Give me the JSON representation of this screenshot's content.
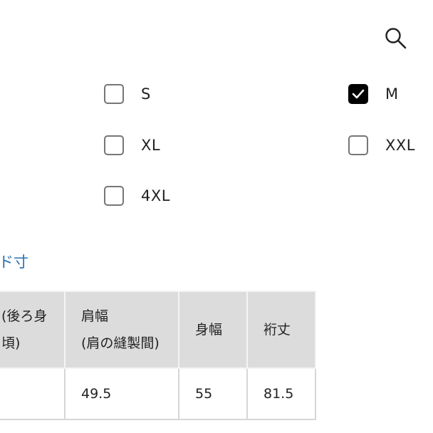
{
  "header": {
    "search_icon": "search-icon"
  },
  "size_options": [
    {
      "label": "S",
      "checked": false
    },
    {
      "label": "M",
      "checked": true
    },
    {
      "label": "XL",
      "checked": false
    },
    {
      "label": "XXL",
      "checked": false
    },
    {
      "label": "4XL",
      "checked": false
    }
  ],
  "section": {
    "link_text": "ヌード寸"
  },
  "table": {
    "headers": {
      "back_length": "(後ろ身頃)",
      "shoulder_line1": "肩幅",
      "shoulder_line2": "(肩の縫製間)",
      "body_width": "身幅",
      "sleeve": "裄丈"
    },
    "row": {
      "back_length": "",
      "shoulder": "49.5",
      "body_width": "55",
      "sleeve": "81.5"
    }
  },
  "colors": {
    "link": "#2a6fb0",
    "checkbox_border": "#767676",
    "checkbox_checked": "#000000",
    "header_bg": "#dcdcdc"
  }
}
